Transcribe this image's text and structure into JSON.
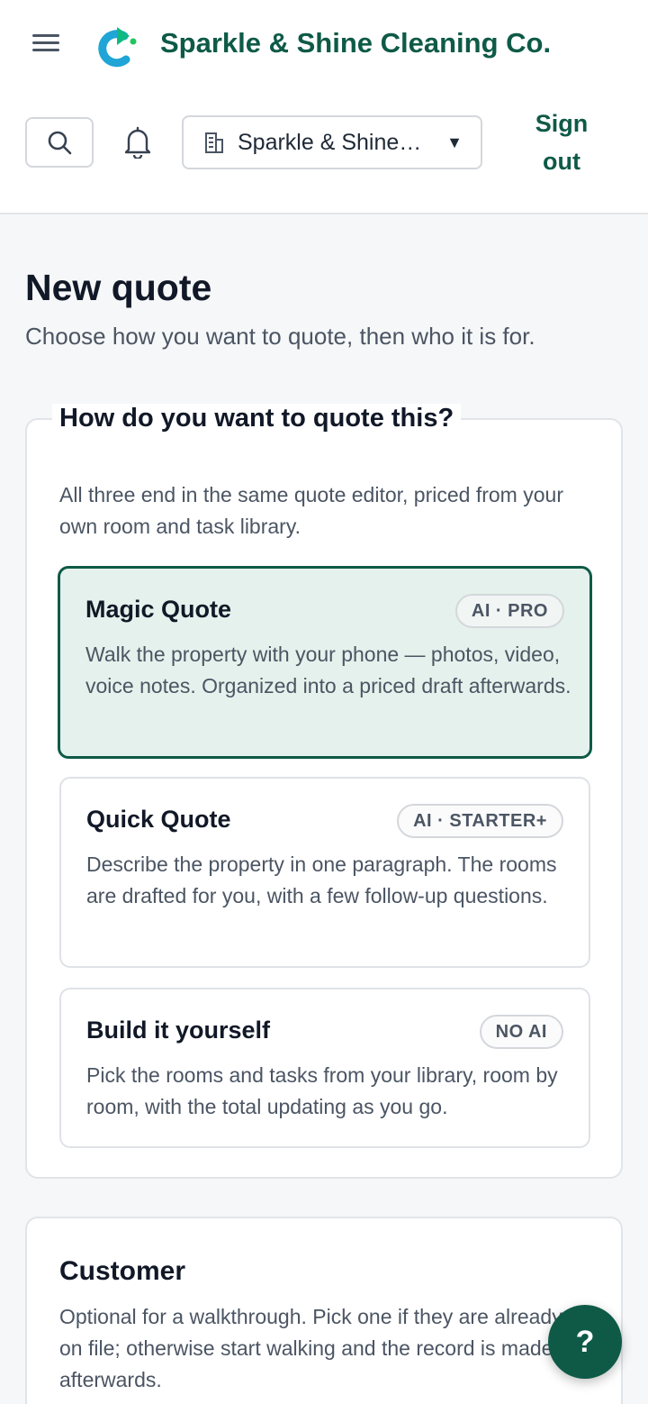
{
  "header": {
    "brand_name": "Sparkle & Shine Cleaning Co.",
    "organization_select": {
      "selected": "Sparkle & Shine Cleaning Co."
    },
    "sign_out_label": "Sign out"
  },
  "page": {
    "title": "New quote",
    "subtitle": "Choose how you want to quote, then who it is for."
  },
  "quote_method": {
    "legend": "How do you want to quote this?",
    "description": "All three end in the same quote editor, priced from your own room and task library.",
    "options": [
      {
        "title": "Magic Quote",
        "badge": "AI · PRO",
        "description": "Walk the property with your phone — photos, video, voice notes. Organized into a priced draft afterwards.",
        "selected": true
      },
      {
        "title": "Quick Quote",
        "badge": "AI · STARTER+",
        "description": "Describe the property in one paragraph. The rooms are drafted for you, with a few follow-up questions.",
        "selected": false
      },
      {
        "title": "Build it yourself",
        "badge": "NO AI",
        "description": "Pick the rooms and tasks from your library, room by room, with the total updating as you go.",
        "selected": false
      }
    ]
  },
  "customer": {
    "title": "Customer",
    "description": "Optional for a walkthrough. Pick one if they are already on file; otherwise start walking and the record is made afterwards."
  },
  "help_button": {
    "label": "?"
  },
  "colors": {
    "brand": "#0e5a47",
    "logo_blue": "#1fa5d6",
    "logo_green": "#22c55e",
    "selected_bg": "#e5f1ec"
  },
  "icons": {
    "menu": "hamburger-menu-icon",
    "search": "search-icon",
    "notifications": "bell-icon",
    "organization": "building-icon",
    "dropdown": "caret-down-icon"
  }
}
